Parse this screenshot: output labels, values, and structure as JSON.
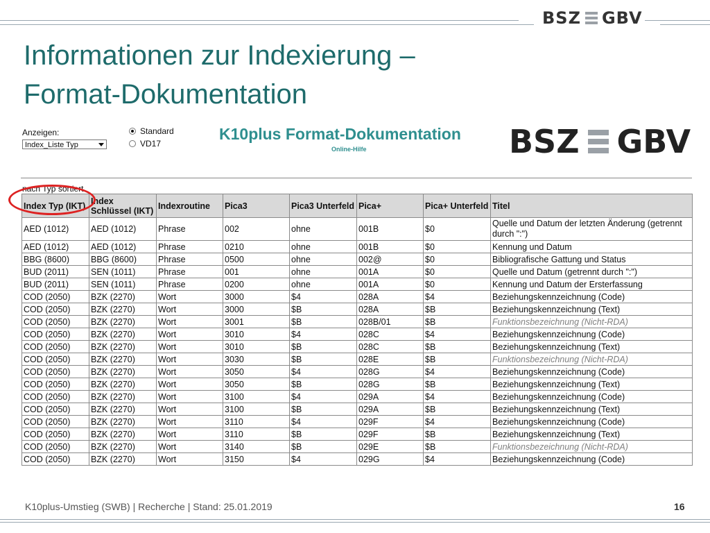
{
  "header": {
    "logo_left": "BSZ",
    "logo_right": "GBV"
  },
  "slide": {
    "title_line1": "Informationen zur Indexierung –",
    "title_line2": "Format-Dokumentation"
  },
  "screenshot": {
    "display_label": "Anzeigen:",
    "display_select_value": "Index_Liste Typ",
    "radio_options": [
      {
        "label": "Standard",
        "checked": true
      },
      {
        "label": "VD17",
        "checked": false
      }
    ],
    "doc_title": "K10plus Format-Dokumentation",
    "doc_subtitle": "Online-Hilfe",
    "logo_left": "BSZ",
    "logo_right": "GBV",
    "sort_label": "nach Typ sortiert",
    "table": {
      "headers": [
        "Index Typ (IKT)",
        "Index Schlüssel (IKT)",
        "Indexroutine",
        "Pica3",
        "Pica3 Unterfeld",
        "Pica+",
        "Pica+ Unterfeld",
        "Titel"
      ],
      "rows": [
        [
          "AED (1012)",
          "AED (1012)",
          "Phrase",
          "002",
          "ohne",
          "001B",
          "$0",
          "Quelle und Datum der letzten Änderung (getrennt durch \":\")"
        ],
        [
          "AED (1012)",
          "AED (1012)",
          "Phrase",
          "0210",
          "ohne",
          "001B",
          "$0",
          "Kennung und Datum"
        ],
        [
          "BBG (8600)",
          "BBG (8600)",
          "Phrase",
          "0500",
          "ohne",
          "002@",
          "$0",
          "Bibliografische Gattung und Status"
        ],
        [
          "BUD (2011)",
          "SEN (1011)",
          "Phrase",
          "001",
          "ohne",
          "001A",
          "$0",
          "Quelle und Datum (getrennt durch \":\")"
        ],
        [
          "BUD (2011)",
          "SEN (1011)",
          "Phrase",
          "0200",
          "ohne",
          "001A",
          "$0",
          "Kennung und Datum der Ersterfassung"
        ],
        [
          "COD (2050)",
          "BZK (2270)",
          "Wort",
          "3000",
          "$4",
          "028A",
          "$4",
          "Beziehungskennzeichnung (Code)"
        ],
        [
          "COD (2050)",
          "BZK (2270)",
          "Wort",
          "3000",
          "$B",
          "028A",
          "$B",
          "Beziehungskennzeichnung (Text)"
        ],
        [
          "COD (2050)",
          "BZK (2270)",
          "Wort",
          "3001",
          "$B",
          "028B/01",
          "$B",
          "Funktionsbezeichnung (Nicht-RDA)"
        ],
        [
          "COD (2050)",
          "BZK (2270)",
          "Wort",
          "3010",
          "$4",
          "028C",
          "$4",
          "Beziehungskennzeichnung (Code)"
        ],
        [
          "COD (2050)",
          "BZK (2270)",
          "Wort",
          "3010",
          "$B",
          "028C",
          "$B",
          "Beziehungskennzeichnung (Text)"
        ],
        [
          "COD (2050)",
          "BZK (2270)",
          "Wort",
          "3030",
          "$B",
          "028E",
          "$B",
          "Funktionsbezeichnung (Nicht-RDA)"
        ],
        [
          "COD (2050)",
          "BZK (2270)",
          "Wort",
          "3050",
          "$4",
          "028G",
          "$4",
          "Beziehungskennzeichnung (Code)"
        ],
        [
          "COD (2050)",
          "BZK (2270)",
          "Wort",
          "3050",
          "$B",
          "028G",
          "$B",
          "Beziehungskennzeichnung (Text)"
        ],
        [
          "COD (2050)",
          "BZK (2270)",
          "Wort",
          "3100",
          "$4",
          "029A",
          "$4",
          "Beziehungskennzeichnung (Code)"
        ],
        [
          "COD (2050)",
          "BZK (2270)",
          "Wort",
          "3100",
          "$B",
          "029A",
          "$B",
          "Beziehungskennzeichnung (Text)"
        ],
        [
          "COD (2050)",
          "BZK (2270)",
          "Wort",
          "3110",
          "$4",
          "029F",
          "$4",
          "Beziehungskennzeichnung (Code)"
        ],
        [
          "COD (2050)",
          "BZK (2270)",
          "Wort",
          "3110",
          "$B",
          "029F",
          "$B",
          "Beziehungskennzeichnung (Text)"
        ],
        [
          "COD (2050)",
          "BZK (2270)",
          "Wort",
          "3140",
          "$B",
          "029E",
          "$B",
          "Funktionsbezeichnung (Nicht-RDA)"
        ],
        [
          "COD (2050)",
          "BZK (2270)",
          "Wort",
          "3150",
          "$4",
          "029G",
          "$4",
          "Beziehungskennzeichnung (Code)"
        ]
      ],
      "greyed_titles": [
        "Funktionsbezeichnung (Nicht-RDA)"
      ]
    }
  },
  "footer": {
    "text": "K10plus-Umstieg (SWB) | Recherche | Stand: 25.01.2019",
    "page_number": "16"
  },
  "colors": {
    "title": "#1e6b6b",
    "doc_title": "#2f8f8f",
    "highlight_circle": "#dd2222",
    "table_header_bg": "#d9d9d9"
  }
}
